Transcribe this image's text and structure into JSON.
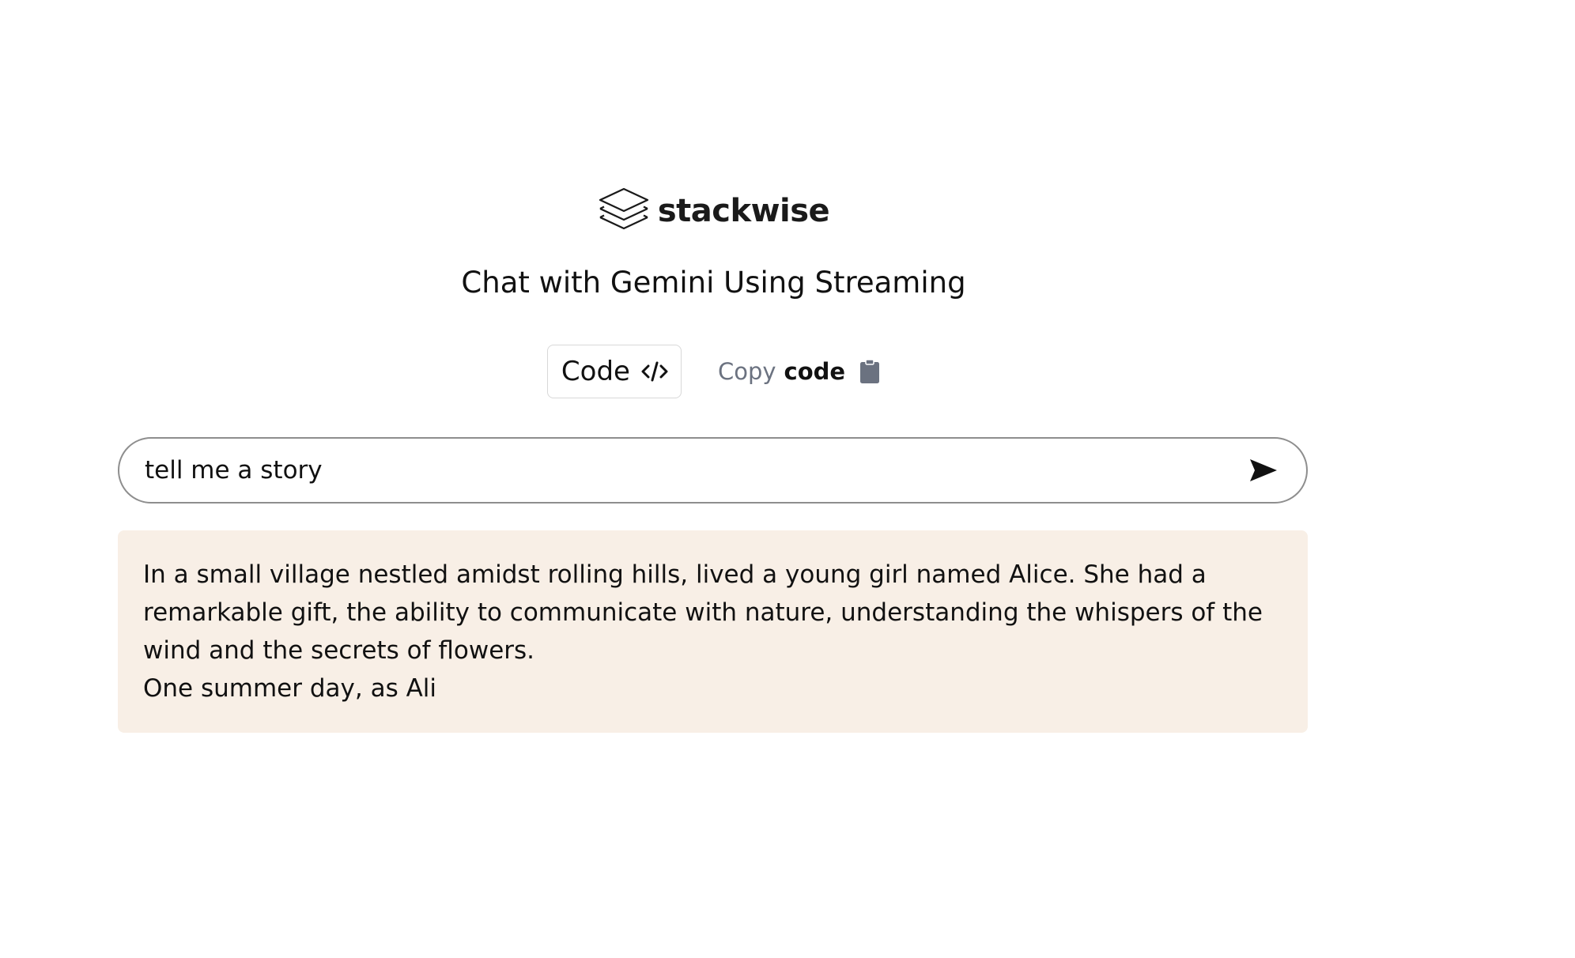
{
  "brand": {
    "name": "stackwise",
    "logo_icon": "stacked-layers-icon"
  },
  "page": {
    "title": "Chat with Gemini Using Streaming"
  },
  "actions": {
    "code_label": "Code",
    "code_icon": "code-brackets-icon",
    "copy_light": "Copy",
    "copy_bold": "code",
    "copy_icon": "clipboard-icon"
  },
  "chat": {
    "input_value": "tell me a story",
    "send_icon": "send-arrow-icon",
    "response": "In a small village nestled amidst rolling hills, lived a young girl named Alice. She had a remarkable gift, the ability to communicate with nature, understanding the whispers of the wind and the secrets of flowers.\nOne summer day, as Ali"
  },
  "colors": {
    "response_background": "#f8efe6",
    "input_border": "#8e8e8e",
    "muted_text": "#6b7280"
  }
}
